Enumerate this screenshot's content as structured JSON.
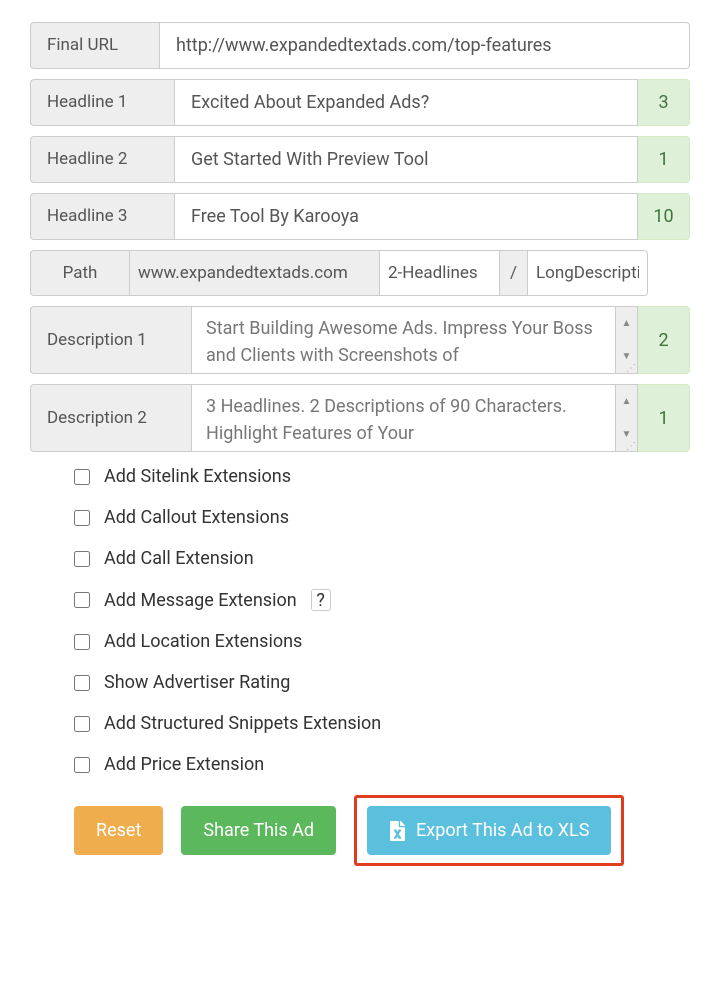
{
  "fields": {
    "final_url": {
      "label": "Final URL",
      "value": "http://www.expandedtextads.com/top-features"
    },
    "headline1": {
      "label": "Headline 1",
      "value": "Excited About Expanded Ads?",
      "count": "3"
    },
    "headline2": {
      "label": "Headline 2",
      "value": "Get Started With Preview Tool",
      "count": "1"
    },
    "headline3": {
      "label": "Headline 3",
      "value": "Free Tool By Karooya",
      "count": "10"
    },
    "path": {
      "label": "Path",
      "domain": "www.expandedtextads.com",
      "p1": "2-Headlines",
      "sep": "/",
      "p2": "LongDescription"
    },
    "desc1": {
      "label": "Description 1",
      "value": "Start Building Awesome Ads. Impress Your Boss and Clients with Screenshots of",
      "count": "2"
    },
    "desc2": {
      "label": "Description 2",
      "value": "3 Headlines. 2 Descriptions of 90 Characters. Highlight Features of Your",
      "count": "1"
    }
  },
  "extensions": [
    {
      "label": "Add Sitelink Extensions",
      "help": false
    },
    {
      "label": "Add Callout Extensions",
      "help": false
    },
    {
      "label": "Add Call Extension",
      "help": false
    },
    {
      "label": "Add Message Extension",
      "help": true
    },
    {
      "label": "Add Location Extensions",
      "help": false
    },
    {
      "label": "Show Advertiser Rating",
      "help": false
    },
    {
      "label": "Add Structured Snippets Extension",
      "help": false
    },
    {
      "label": "Add Price Extension",
      "help": false
    }
  ],
  "help_char": "?",
  "buttons": {
    "reset": "Reset",
    "share": "Share This Ad",
    "export": "Export This Ad to XLS"
  }
}
